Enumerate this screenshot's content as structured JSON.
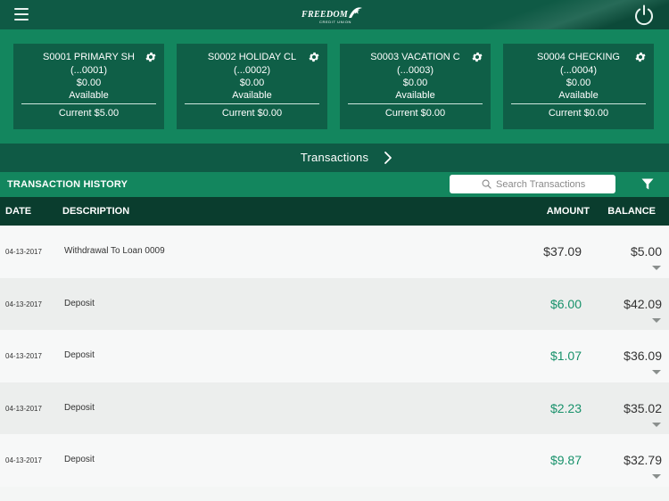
{
  "colors": {
    "dark_green": "#0f5a45",
    "accent_green": "#13865e",
    "card_green": "#0f5f47",
    "header_dark": "#0a3d2e",
    "credit_green": "#17916a"
  },
  "header": {
    "logo_word": "FREEDOM",
    "logo_sub": "CREDIT UNION",
    "menu_icon": "hamburger-icon",
    "power_icon": "power-icon"
  },
  "accounts": [
    {
      "name": "S0001 PRIMARY SH",
      "number": "(...0001)",
      "balance": "$0.00",
      "available_label": "Available",
      "current": "Current $5.00"
    },
    {
      "name": "S0002 HOLIDAY CL",
      "number": "(...0002)",
      "balance": "$0.00",
      "available_label": "Available",
      "current": "Current $0.00"
    },
    {
      "name": "S0003 VACATION C",
      "number": "(...0003)",
      "balance": "$0.00",
      "available_label": "Available",
      "current": "Current $0.00"
    },
    {
      "name": "S0004 CHECKING",
      "number": "(...0004)",
      "balance": "$0.00",
      "available_label": "Available",
      "current": "Current $0.00"
    }
  ],
  "nav": {
    "transactions_label": "Transactions"
  },
  "history": {
    "title": "TRANSACTION HISTORY",
    "search_placeholder": "Search Transactions"
  },
  "columns": {
    "date": "DATE",
    "description": "DESCRIPTION",
    "amount": "AMOUNT",
    "balance": "BALANCE"
  },
  "transactions": [
    {
      "date": "04-13-2017",
      "description": "Withdrawal To Loan 0009",
      "amount": "$37.09",
      "balance": "$5.00",
      "type": "debit"
    },
    {
      "date": "04-13-2017",
      "description": "Deposit",
      "amount": "$6.00",
      "balance": "$42.09",
      "type": "credit"
    },
    {
      "date": "04-13-2017",
      "description": "Deposit",
      "amount": "$1.07",
      "balance": "$36.09",
      "type": "credit"
    },
    {
      "date": "04-13-2017",
      "description": "Deposit",
      "amount": "$2.23",
      "balance": "$35.02",
      "type": "credit"
    },
    {
      "date": "04-13-2017",
      "description": "Deposit",
      "amount": "$9.87",
      "balance": "$32.79",
      "type": "credit"
    }
  ]
}
